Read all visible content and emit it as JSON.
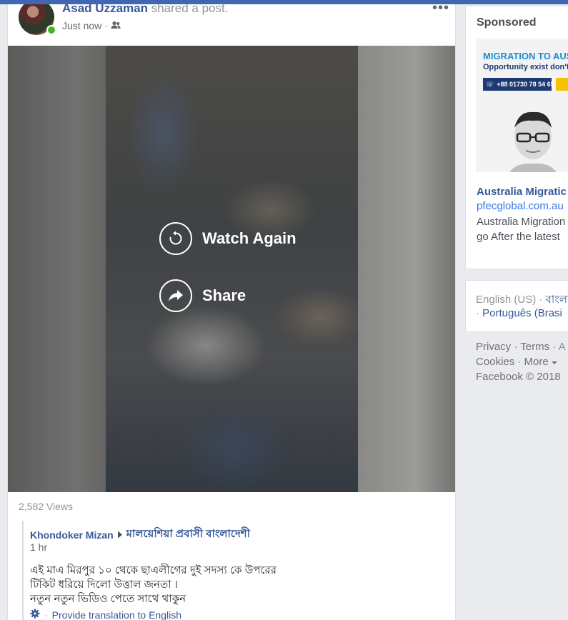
{
  "post": {
    "author": "Asad Uzzaman",
    "action": " shared a post.",
    "time": "Just now",
    "audience_icon": "friends-icon",
    "more_icon": "more-options-icon",
    "views": "2,582 Views",
    "video": {
      "watch_again_label": "Watch Again",
      "share_label": "Share"
    },
    "shared": {
      "author": "Khondoker Mizan",
      "group": "মালয়েশিয়া প্রবাসী বাংলাদেশী",
      "time": "1 hr",
      "text_lines": [
        "এই মাএ মিরপুর ১০ থেকে ছাএলীগের দুই সদস্য কে উপরের",
        "টিকিট ধরিয়ে দিলো উত্তাল জনতা ।",
        "নতুন নতুন ভিডিও পেতে সাথে থাকুন"
      ],
      "translate_label": "Provide translation to English"
    }
  },
  "sidebar": {
    "sponsored_title": "Sponsored",
    "ad": {
      "image_headline": "MIGRATION TO AUS",
      "image_subline": "Opportunity exist don't",
      "image_phone": "+88 01730 78 54 65",
      "name": "Australia Migratic",
      "url": "pfecglobal.com.au",
      "desc_lines": [
        "Australia Migration",
        "go After the latest"
      ]
    },
    "languages": {
      "current": "English (US)",
      "other": "বাংলা",
      "second_line": "Português (Brasi"
    },
    "footer": {
      "privacy": "Privacy",
      "terms": "Terms",
      "cookies": "Cookies",
      "more": "More",
      "copyright": "Facebook © 2018"
    }
  },
  "colors": {
    "brand_blue": "#4267b2",
    "link_blue": "#385898",
    "online_green": "#42b72a"
  }
}
